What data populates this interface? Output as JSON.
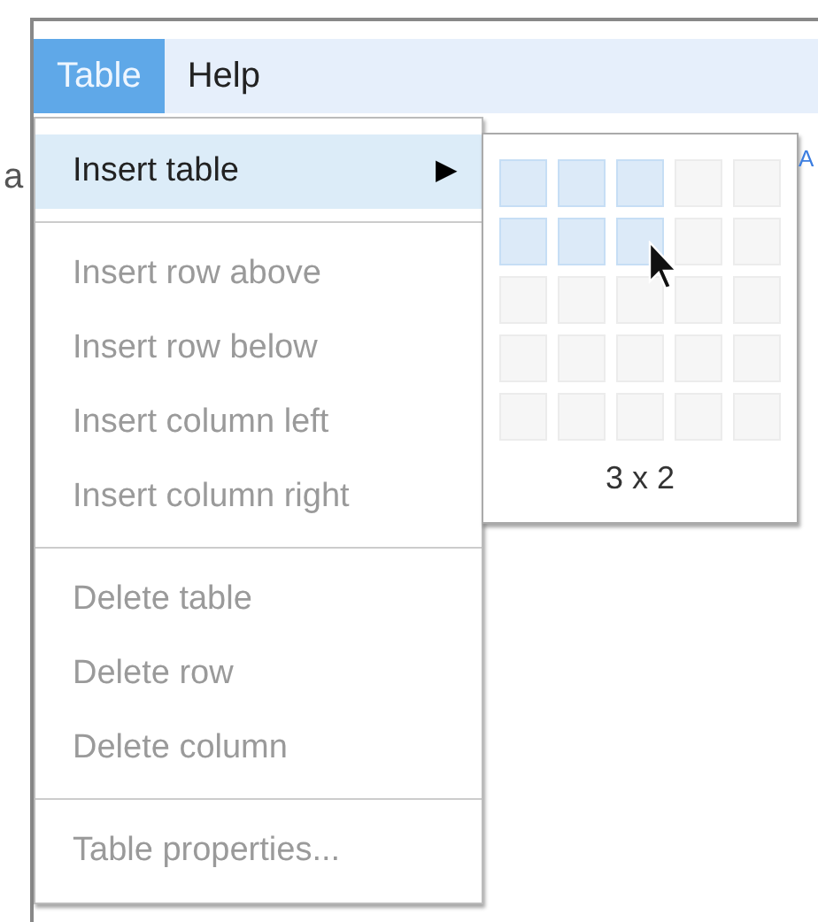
{
  "menubar": [
    {
      "label": "Table",
      "selected": true
    },
    {
      "label": "Help",
      "selected": false
    }
  ],
  "toolbar_fragments": {
    "left": "a",
    "right": "A"
  },
  "menu": {
    "groups": [
      {
        "items": [
          {
            "label": "Insert table",
            "disabled": false,
            "highlighted": true,
            "submenu": true
          }
        ]
      },
      {
        "items": [
          {
            "label": "Insert row above",
            "disabled": true,
            "highlighted": false,
            "submenu": false
          },
          {
            "label": "Insert row below",
            "disabled": true,
            "highlighted": false,
            "submenu": false
          },
          {
            "label": "Insert column left",
            "disabled": true,
            "highlighted": false,
            "submenu": false
          },
          {
            "label": "Insert column right",
            "disabled": true,
            "highlighted": false,
            "submenu": false
          }
        ]
      },
      {
        "items": [
          {
            "label": "Delete table",
            "disabled": true,
            "highlighted": false,
            "submenu": false
          },
          {
            "label": "Delete row",
            "disabled": true,
            "highlighted": false,
            "submenu": false
          },
          {
            "label": "Delete column",
            "disabled": true,
            "highlighted": false,
            "submenu": false
          }
        ]
      },
      {
        "items": [
          {
            "label": "Table properties...",
            "disabled": true,
            "highlighted": false,
            "submenu": false
          }
        ]
      }
    ],
    "submenu_arrow": "▶"
  },
  "size_picker": {
    "rows": [
      {
        "cells": [
          {
            "selected": true
          },
          {
            "selected": true
          },
          {
            "selected": true
          },
          {
            "selected": false
          },
          {
            "selected": false
          }
        ]
      },
      {
        "cells": [
          {
            "selected": true
          },
          {
            "selected": true
          },
          {
            "selected": true
          },
          {
            "selected": false
          },
          {
            "selected": false
          }
        ]
      },
      {
        "cells": [
          {
            "selected": false
          },
          {
            "selected": false
          },
          {
            "selected": false
          },
          {
            "selected": false
          },
          {
            "selected": false
          }
        ]
      },
      {
        "cells": [
          {
            "selected": false
          },
          {
            "selected": false
          },
          {
            "selected": false
          },
          {
            "selected": false
          },
          {
            "selected": false
          }
        ]
      },
      {
        "cells": [
          {
            "selected": false
          },
          {
            "selected": false
          },
          {
            "selected": false
          },
          {
            "selected": false
          },
          {
            "selected": false
          }
        ]
      }
    ],
    "label": "3 x 2"
  }
}
